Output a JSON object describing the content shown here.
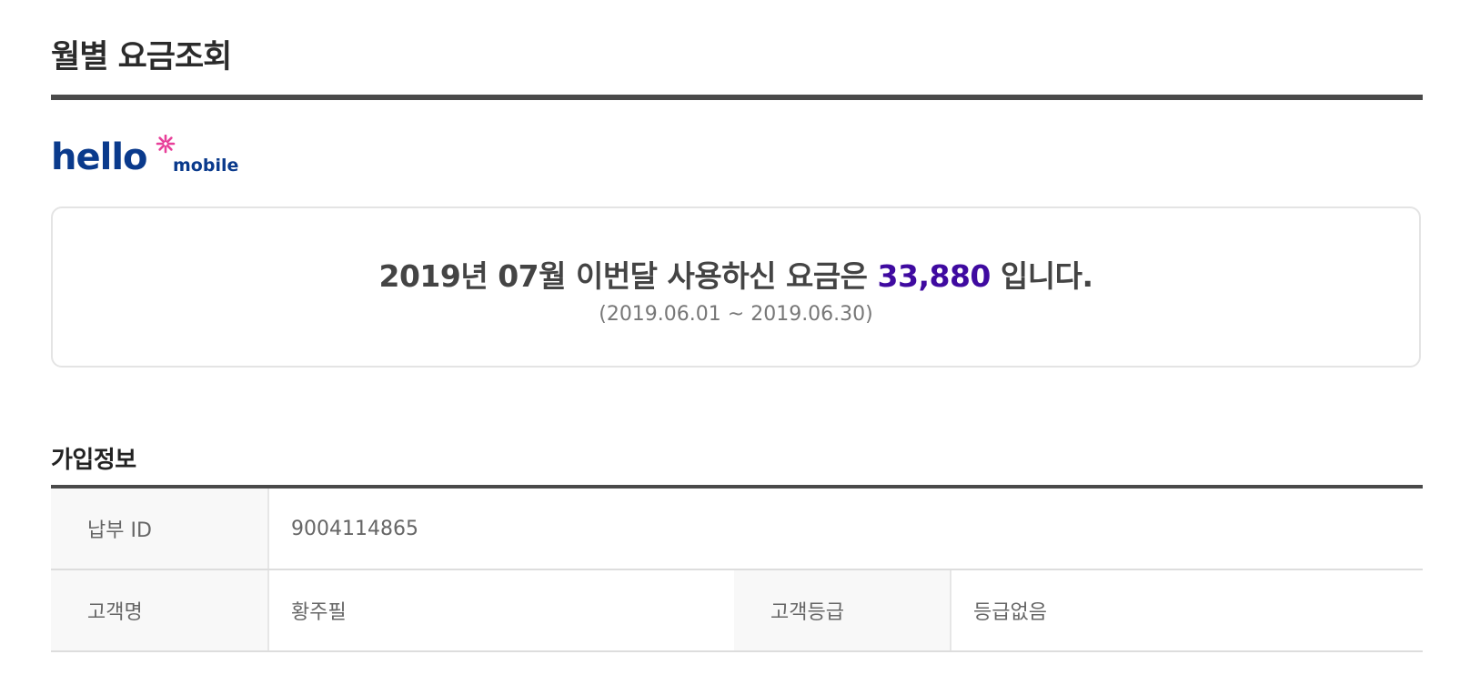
{
  "page": {
    "title": "월별 요금조회"
  },
  "logo": {
    "brand_word": "hello",
    "brand_sub": "mobile",
    "brand_color": "#0a3a8c",
    "star_color": "#e8409a"
  },
  "summary": {
    "text_before": "2019년 07월 이번달 사용하신 요금은 ",
    "amount": "33,880",
    "text_after": " 입니다.",
    "period": "(2019.06.01 ~ 2019.06.30)",
    "amount_color": "#3f0aa0"
  },
  "subscription": {
    "section_title": "가입정보",
    "rows": [
      {
        "label": "납부 ID",
        "value": "9004114865"
      },
      {
        "label": "고객명",
        "value": "황주필",
        "label2": "고객등급",
        "value2": "등급없음"
      }
    ]
  }
}
